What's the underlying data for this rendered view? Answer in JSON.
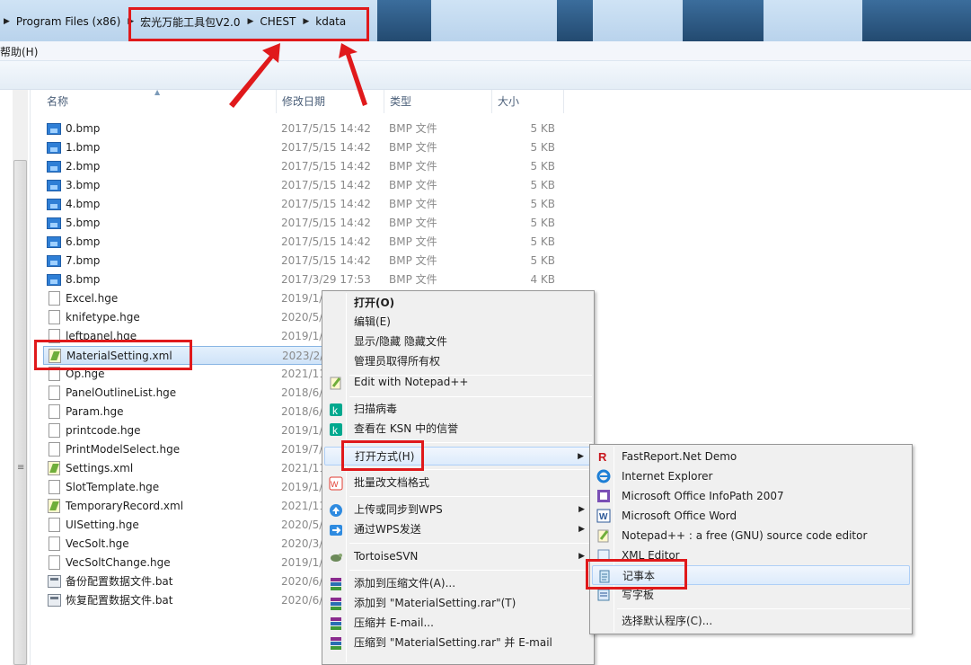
{
  "address": {
    "crumbs": [
      "Program Files (x86)",
      "宏光万能工具包V2.0",
      "CHEST",
      "kdata"
    ]
  },
  "menubar": {
    "help": "帮助(H)"
  },
  "columns": {
    "name": "名称",
    "date": "修改日期",
    "type": "类型",
    "size": "大小"
  },
  "files": [
    {
      "name": "0.bmp",
      "date": "2017/5/15 14:42",
      "type": "BMP 文件",
      "size": "5 KB",
      "icon": "bmp-image-icon"
    },
    {
      "name": "1.bmp",
      "date": "2017/5/15 14:42",
      "type": "BMP 文件",
      "size": "5 KB",
      "icon": "bmp-image-icon"
    },
    {
      "name": "2.bmp",
      "date": "2017/5/15 14:42",
      "type": "BMP 文件",
      "size": "5 KB",
      "icon": "bmp-image-icon"
    },
    {
      "name": "3.bmp",
      "date": "2017/5/15 14:42",
      "type": "BMP 文件",
      "size": "5 KB",
      "icon": "bmp-image-icon"
    },
    {
      "name": "4.bmp",
      "date": "2017/5/15 14:42",
      "type": "BMP 文件",
      "size": "5 KB",
      "icon": "bmp-image-icon"
    },
    {
      "name": "5.bmp",
      "date": "2017/5/15 14:42",
      "type": "BMP 文件",
      "size": "5 KB",
      "icon": "bmp-image-icon"
    },
    {
      "name": "6.bmp",
      "date": "2017/5/15 14:42",
      "type": "BMP 文件",
      "size": "5 KB",
      "icon": "bmp-image-icon"
    },
    {
      "name": "7.bmp",
      "date": "2017/5/15 14:42",
      "type": "BMP 文件",
      "size": "5 KB",
      "icon": "bmp-image-icon"
    },
    {
      "name": "8.bmp",
      "date": "2017/3/29 17:53",
      "type": "BMP 文件",
      "size": "4 KB",
      "icon": "bmp-image-icon"
    },
    {
      "name": "Excel.hge",
      "date": "2019/1/",
      "type": "",
      "size": "",
      "icon": "file-icon"
    },
    {
      "name": "knifetype.hge",
      "date": "2020/5/",
      "type": "",
      "size": "",
      "icon": "file-icon"
    },
    {
      "name": "leftpanel.hge",
      "date": "2019/1/",
      "type": "",
      "size": "",
      "icon": "file-icon"
    },
    {
      "name": "MaterialSetting.xml",
      "date": "2023/2/",
      "type": "",
      "size": "",
      "icon": "xml-file-icon"
    },
    {
      "name": "Op.hge",
      "date": "2021/11",
      "type": "",
      "size": "",
      "icon": "file-icon"
    },
    {
      "name": "PanelOutlineList.hge",
      "date": "2018/6/",
      "type": "",
      "size": "",
      "icon": "file-icon"
    },
    {
      "name": "Param.hge",
      "date": "2018/6/",
      "type": "",
      "size": "",
      "icon": "file-icon"
    },
    {
      "name": "printcode.hge",
      "date": "2019/1/",
      "type": "",
      "size": "",
      "icon": "file-icon"
    },
    {
      "name": "PrintModelSelect.hge",
      "date": "2019/7/",
      "type": "",
      "size": "",
      "icon": "file-icon"
    },
    {
      "name": "Settings.xml",
      "date": "2021/11",
      "type": "",
      "size": "",
      "icon": "xml-file-icon"
    },
    {
      "name": "SlotTemplate.hge",
      "date": "2019/1/",
      "type": "",
      "size": "",
      "icon": "file-icon"
    },
    {
      "name": "TemporaryRecord.xml",
      "date": "2021/11",
      "type": "",
      "size": "",
      "icon": "xml-file-icon"
    },
    {
      "name": "UISetting.hge",
      "date": "2020/5/",
      "type": "",
      "size": "",
      "icon": "file-icon"
    },
    {
      "name": "VecSolt.hge",
      "date": "2020/3/",
      "type": "",
      "size": "",
      "icon": "file-icon"
    },
    {
      "name": "VecSoltChange.hge",
      "date": "2019/1/",
      "type": "",
      "size": "",
      "icon": "file-icon"
    },
    {
      "name": "备份配置数据文件.bat",
      "date": "2020/6/",
      "type": "",
      "size": "",
      "icon": "batch-file-icon"
    },
    {
      "name": "恢复配置数据文件.bat",
      "date": "2020/6/",
      "type": "",
      "size": "",
      "icon": "batch-file-icon"
    }
  ],
  "context_menu": {
    "open": "打开(O)",
    "edit": "编辑(E)",
    "toggle_hidden": "显示/隐藏 隐藏文件",
    "take_ownership": "管理员取得所有权",
    "notepadpp": "Edit with Notepad++",
    "scan": "扫描病毒",
    "ksn": "查看在 KSN 中的信誉",
    "open_with": "打开方式(H)",
    "batch_convert": "批量改文档格式",
    "upload_wps": "上传或同步到WPS",
    "send_wps": "通过WPS发送",
    "tortoise": "TortoiseSVN",
    "add_archive": "添加到压缩文件(A)...",
    "add_rar": "添加到 \"MaterialSetting.rar\"(T)",
    "compress_email": "压缩并 E-mail...",
    "compress_rar_email": "压缩到 \"MaterialSetting.rar\" 并 E-mail"
  },
  "open_with_menu": [
    {
      "label": "FastReport.Net Demo",
      "icon": "fastreport-icon"
    },
    {
      "label": "Internet Explorer",
      "icon": "ie-icon"
    },
    {
      "label": "Microsoft Office InfoPath 2007",
      "icon": "infopath-icon"
    },
    {
      "label": "Microsoft Office Word",
      "icon": "word-icon"
    },
    {
      "label": "Notepad++ : a free (GNU) source code editor",
      "icon": "notepadpp-icon"
    },
    {
      "label": "XML Editor",
      "icon": "xml-editor-icon"
    },
    {
      "label": "记事本",
      "icon": "notepad-icon"
    },
    {
      "label": "写字板",
      "icon": "wordpad-icon"
    },
    {
      "label": "选择默认程序(C)...",
      "icon": ""
    }
  ],
  "colors": {
    "highlight_red": "#e0191b",
    "selection_blue": "#cfe3f8"
  }
}
